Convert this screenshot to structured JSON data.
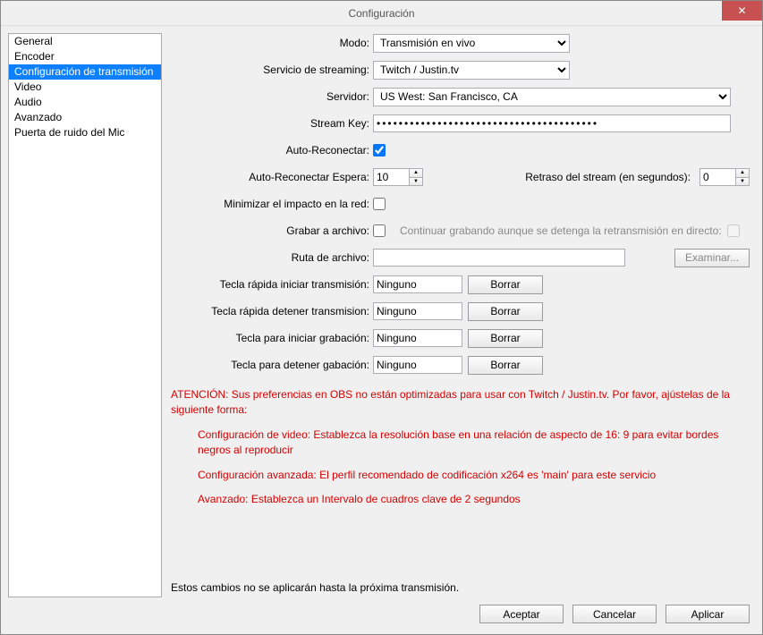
{
  "window": {
    "title": "Configuración"
  },
  "sidebar": {
    "items": [
      {
        "label": "General",
        "selected": false
      },
      {
        "label": "Encoder",
        "selected": false
      },
      {
        "label": "Configuración de transmisión",
        "selected": true
      },
      {
        "label": "Video",
        "selected": false
      },
      {
        "label": "Audio",
        "selected": false
      },
      {
        "label": "Avanzado",
        "selected": false
      },
      {
        "label": "Puerta de ruido del Mic",
        "selected": false
      }
    ]
  },
  "form": {
    "mode_label": "Modo:",
    "mode_value": "Transmisión en vivo",
    "service_label": "Servicio de streaming:",
    "service_value": "Twitch / Justin.tv",
    "server_label": "Servidor:",
    "server_value": "US West: San Francisco, CA",
    "streamkey_label": "Stream Key:",
    "streamkey_value": "••••••••••••••••••••••••••••••••••••••••",
    "autoreconnect_label": "Auto-Reconectar:",
    "autoreconnect_wait_label": "Auto-Reconectar Espera:",
    "autoreconnect_wait_value": "10",
    "delay_label": "Retraso del stream (en segundos):",
    "delay_value": "0",
    "minimize_label": "Minimizar el impacto en la red:",
    "record_label": "Grabar a archivo:",
    "continue_record_label": "Continuar grabando aunque se detenga la retransmisión en directo:",
    "path_label": "Ruta de archivo:",
    "browse_label": "Examinar...",
    "hk_start_stream_label": "Tecla rápida iniciar transmisión:",
    "hk_stop_stream_label": "Tecla rápida detener transmision:",
    "hk_start_record_label": "Tecla para iniciar grabación:",
    "hk_stop_record_label": "Tecla para detener gabación:",
    "hk_value": "Ninguno",
    "clear_label": "Borrar"
  },
  "warnings": {
    "line1": "ATENCIÓN: Sus preferencias en OBS no están optimizadas para usar con Twitch / Justin.tv. Por favor, ajústelas de la siguiente forma:",
    "line2": "Configuración de video: Establezca la resolución base en una relación de aspecto de 16: 9 para evitar bordes negros al reproducir",
    "line3": "Configuración avanzada: El perfil recomendado de codificación x264 es 'main' para este servicio",
    "line4": "Avanzado: Establezca un Intervalo de cuadros clave de 2 segundos"
  },
  "note": "Estos cambios no se aplicarán hasta la próxima transmisión.",
  "buttons": {
    "ok": "Aceptar",
    "cancel": "Cancelar",
    "apply": "Aplicar"
  }
}
